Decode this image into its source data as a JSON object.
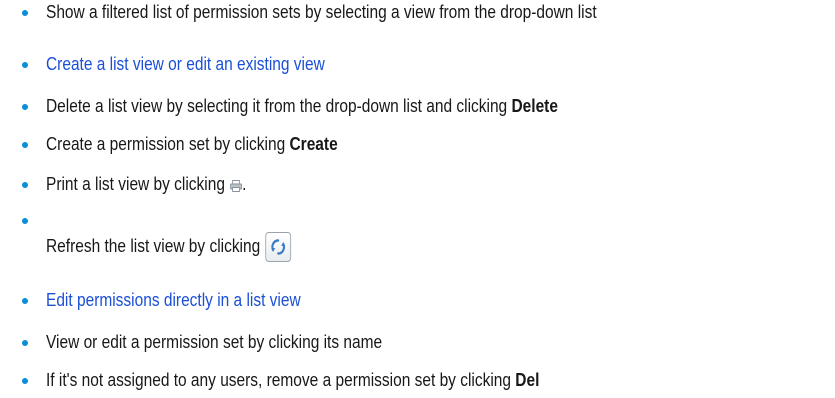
{
  "items": [
    {
      "text": "Show a filtered list of permission sets by selecting a view from the drop-down list"
    },
    {
      "link": "Create a list view or edit an existing view"
    },
    {
      "text": "Delete a list view by selecting it from the drop-down list and clicking ",
      "bold": "Delete"
    },
    {
      "text": "Create a permission set by clicking ",
      "bold": "Create"
    },
    {
      "text": "Print a list view by clicking",
      "after": "."
    },
    {
      "text": "Refresh the list view by clicking"
    },
    {
      "link": "Edit permissions directly in a list view"
    },
    {
      "text": "View or edit a permission set by clicking its name"
    },
    {
      "text": "If it's not assigned to any users, remove a permission set by clicking ",
      "bold": "Del"
    }
  ],
  "icons": {
    "print": "printer-icon",
    "refresh": "refresh-icon"
  },
  "colors": {
    "bullet": "#0b8ed9",
    "link": "#1a4fd6",
    "text": "#181818"
  }
}
